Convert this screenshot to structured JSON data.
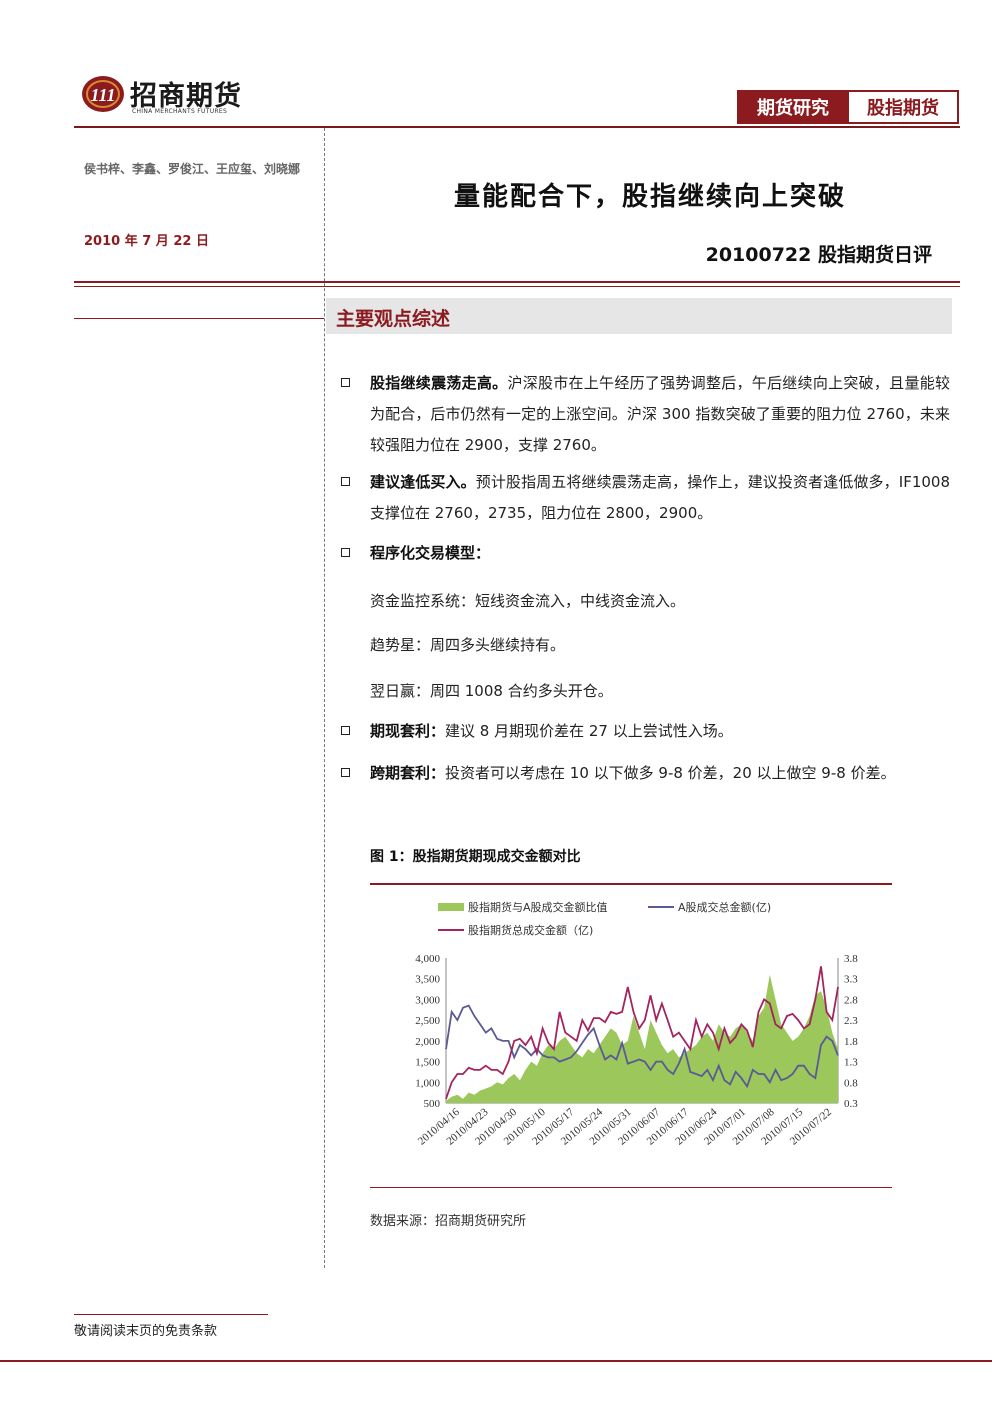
{
  "header": {
    "logo_cn": "招商期货",
    "logo_en": "CHINA MERCHANTS FUTURES",
    "tag1": "期货研究",
    "tag2": "股指期货"
  },
  "sidebar": {
    "authors": "侯书梓、李鑫、罗俊江、王应玺、刘晓娜",
    "date": "2010 年 7 月 22 日"
  },
  "title": "量能配合下，股指继续向上突破",
  "subtitle": "20100722 股指期货日评",
  "section": {
    "title": "主要观点综述"
  },
  "points": [
    {
      "head": "股指继续震荡走高。",
      "text": "沪深股市在上午经历了强势调整后，午后继续向上突破，且量能较为配合，后市仍然有一定的上涨空间。沪深 300 指数突破了重要的阻力位 2760，未来较强阻力位在 2900，支撑 2760。"
    },
    {
      "head": "建议逢低买入。",
      "text": "预计股指周五将继续震荡走高，操作上，建议投资者逢低做多，IF1008 支撑位在 2760，2735，阻力位在 2800，2900。"
    },
    {
      "head": "程序化交易模型：",
      "text": ""
    },
    {
      "head": "期现套利：",
      "text": "建议 8 月期现价差在 27 以上尝试性入场。"
    },
    {
      "head": "跨期套利：",
      "text": "投资者可以考虑在 10 以下做多 9-8 价差，20 以上做空 9-8 价差。"
    }
  ],
  "models": [
    "资金监控系统：短线资金流入，中线资金流入。",
    "趋势星：周四多头继续持有。",
    "翌日赢：周四 1008 合约多头开仓。"
  ],
  "figure": {
    "title": "图 1：股指期货期现成交金额对比",
    "source": "数据来源：招商期货研究所"
  },
  "footer": {
    "note": "敬请阅读末页的免责条款"
  },
  "colors": {
    "brand": "#8b1b1f",
    "ratio_area": "#9bc75b",
    "a_share_line": "#5a5a96",
    "futures_line": "#a3245e"
  },
  "chart_data": {
    "type": "line",
    "legend": [
      "股指期货与A股成交金额比值",
      "A股成交总金额(亿)",
      "股指期货总成交金额（亿)"
    ],
    "legend_placement": "top",
    "x_tick_labels": [
      "2010/04/16",
      "2010/04/23",
      "2010/04/30",
      "2010/05/10",
      "2010/05/17",
      "2010/05/24",
      "2010/05/31",
      "2010/06/07",
      "2010/06/17",
      "2010/06/24",
      "2010/07/01",
      "2010/07/08",
      "2010/07/15",
      "2010/07/22"
    ],
    "y_left_ticks": [
      "4,000",
      "3,500",
      "3,000",
      "2,500",
      "2,000",
      "1,500",
      "1,000",
      "500"
    ],
    "y_right_ticks": [
      "3.8",
      "3.3",
      "2.8",
      "2.3",
      "1.8",
      "1.3",
      "0.8",
      "0.3"
    ],
    "y_left_range": [
      500,
      4000
    ],
    "y_right_range": [
      0.3,
      3.8
    ],
    "grid": false,
    "series": [
      {
        "name": "股指期货与A股成交金额比值",
        "axis": "right",
        "kind": "area",
        "values": [
          0.35,
          0.45,
          0.5,
          0.4,
          0.55,
          0.5,
          0.6,
          0.65,
          0.7,
          0.8,
          0.75,
          0.9,
          1.0,
          0.85,
          1.1,
          1.3,
          1.2,
          1.5,
          1.7,
          1.6,
          1.8,
          1.9,
          1.7,
          1.5,
          1.4,
          1.6,
          1.5,
          1.7,
          1.9,
          2.1,
          2.0,
          1.7,
          1.8,
          2.4,
          2.0,
          1.6,
          2.3,
          2.0,
          1.7,
          1.5,
          1.6,
          1.4,
          1.5,
          1.6,
          1.7,
          1.9,
          2.0,
          1.8,
          2.2,
          2.0,
          1.9,
          2.1,
          2.2,
          2.0,
          1.8,
          2.4,
          2.6,
          3.4,
          2.8,
          2.2,
          2.0,
          1.8,
          1.9,
          2.1,
          2.4,
          2.9,
          3.0,
          2.6,
          2.0,
          1.6
        ]
      },
      {
        "name": "A股成交总金额(亿)",
        "axis": "left",
        "kind": "line",
        "values": [
          1800,
          2700,
          2500,
          2800,
          2850,
          2600,
          2400,
          2200,
          2300,
          2050,
          2000,
          2000,
          1600,
          1900,
          1800,
          1650,
          1800,
          1650,
          1600,
          1600,
          1500,
          1550,
          1600,
          1750,
          1950,
          2150,
          2300,
          1900,
          1550,
          1650,
          1550,
          1950,
          1450,
          1500,
          1550,
          1500,
          1300,
          1500,
          1500,
          1300,
          1200,
          1450,
          1800,
          1250,
          1200,
          1150,
          1300,
          1050,
          1400,
          1050,
          950,
          1250,
          1100,
          900,
          1300,
          1200,
          1200,
          1000,
          1300,
          1050,
          1100,
          1200,
          1400,
          1400,
          1200,
          1100,
          1900,
          2100,
          2000,
          1650
        ]
      },
      {
        "name": "股指期货总成交金额（亿)",
        "axis": "left",
        "kind": "line",
        "values": [
          600,
          1000,
          1200,
          1200,
          1350,
          1300,
          1300,
          1400,
          1300,
          1300,
          1200,
          1500,
          2000,
          2050,
          1900,
          2100,
          1700,
          2300,
          1950,
          1800,
          2700,
          2200,
          2100,
          2000,
          2500,
          2250,
          2550,
          2550,
          2450,
          2700,
          2650,
          2700,
          3300,
          2700,
          2300,
          2500,
          3100,
          2500,
          2900,
          2500,
          2100,
          2200,
          2000,
          1800,
          2500,
          2100,
          2400,
          2200,
          1800,
          2300,
          1950,
          2100,
          2400,
          2250,
          1850,
          2700,
          3000,
          2900,
          2400,
          2300,
          2600,
          2650,
          2500,
          2300,
          2400,
          3000,
          3800,
          2700,
          2500,
          3300
        ]
      }
    ]
  }
}
